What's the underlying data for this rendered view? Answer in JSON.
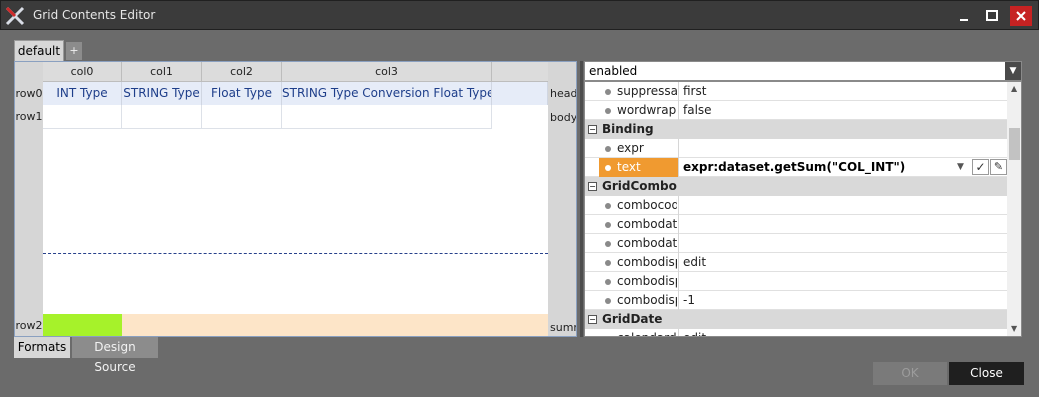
{
  "window": {
    "title": "Grid Contents Editor"
  },
  "tabs": {
    "default_label": "default",
    "add_label": "+"
  },
  "grid": {
    "columns": [
      "col0",
      "col1",
      "col2",
      "col3"
    ],
    "rows": [
      "row0",
      "row1",
      "row2"
    ],
    "head_cells": [
      "INT Type",
      "STRING Type",
      "Float Type",
      "STRING Type Conversion Float Type"
    ],
    "band_labels": [
      "head",
      "body",
      "summ"
    ]
  },
  "bottom_tabs": {
    "formats": "Formats",
    "design_source": "Design Source"
  },
  "properties": {
    "selected_property": "enabled",
    "rows": [
      {
        "name": "suppressalig",
        "value": "first"
      },
      {
        "name": "wordwrap",
        "value": "false"
      }
    ],
    "categories": [
      {
        "name": "Binding",
        "symbol": "−"
      },
      {
        "name": "GridCombo",
        "symbol": "−"
      },
      {
        "name": "GridDate",
        "symbol": "−"
      }
    ],
    "binding_rows": [
      {
        "name": "expr",
        "value": ""
      },
      {
        "name": "text",
        "value": "expr:dataset.getSum(\"COL_INT\")"
      }
    ],
    "combo_rows": [
      {
        "name": "combocodec",
        "value": ""
      },
      {
        "name": "combodatac",
        "value": ""
      },
      {
        "name": "combodatac",
        "value": ""
      },
      {
        "name": "combodispr",
        "value": "edit"
      },
      {
        "name": "combodispr",
        "value": ""
      },
      {
        "name": "combodispr",
        "value": "-1"
      }
    ],
    "date_rows": [
      {
        "name": "calendardis",
        "value": "edit"
      }
    ]
  },
  "buttons": {
    "ok": "OK",
    "close": "Close"
  },
  "colors": {
    "accent": "#f09a30",
    "summary_green": "#a6f22a",
    "summary_peach": "#fde5c8",
    "close_red": "#c62222"
  }
}
